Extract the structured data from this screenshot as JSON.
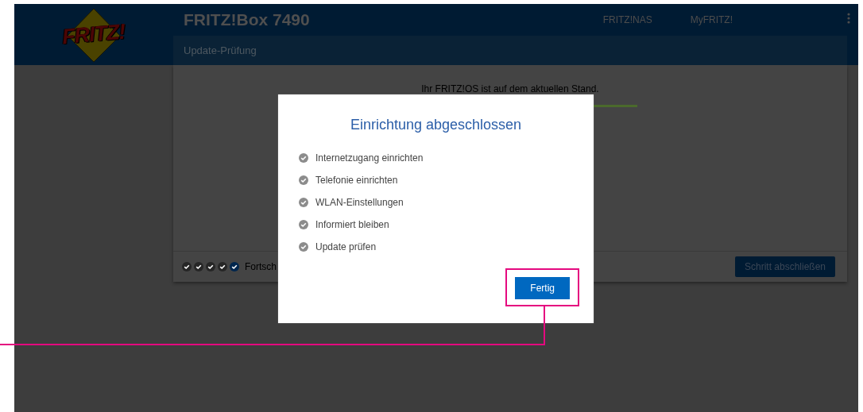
{
  "header": {
    "logo_text": "FRITZ!",
    "title": "FRITZ!Box 7490",
    "nav": [
      "FRITZ!NAS",
      "MyFRITZ!"
    ]
  },
  "subheader": {
    "title": "Update-Prüfung"
  },
  "card": {
    "message": "Ihr FRITZ!OS ist auf dem aktuellen Stand.",
    "progress": {
      "level": 1
    },
    "steps": [
      {
        "current": false
      },
      {
        "current": false
      },
      {
        "current": false
      },
      {
        "current": false
      },
      {
        "current": true
      }
    ],
    "progress_label": "Fortsch",
    "button": "Schritt abschließen"
  },
  "dialog": {
    "title": "Einrichtung abgeschlossen",
    "items": [
      {
        "label": "Internetzugang einrichten",
        "checked": true
      },
      {
        "label": "Telefonie einrichten",
        "checked": true
      },
      {
        "label": "WLAN-Einstellungen",
        "checked": true
      },
      {
        "label": "Informiert bleiben",
        "checked": true
      },
      {
        "label": "Update prüfen",
        "checked": true
      }
    ],
    "button": "Fertig",
    "highlighted": true
  }
}
